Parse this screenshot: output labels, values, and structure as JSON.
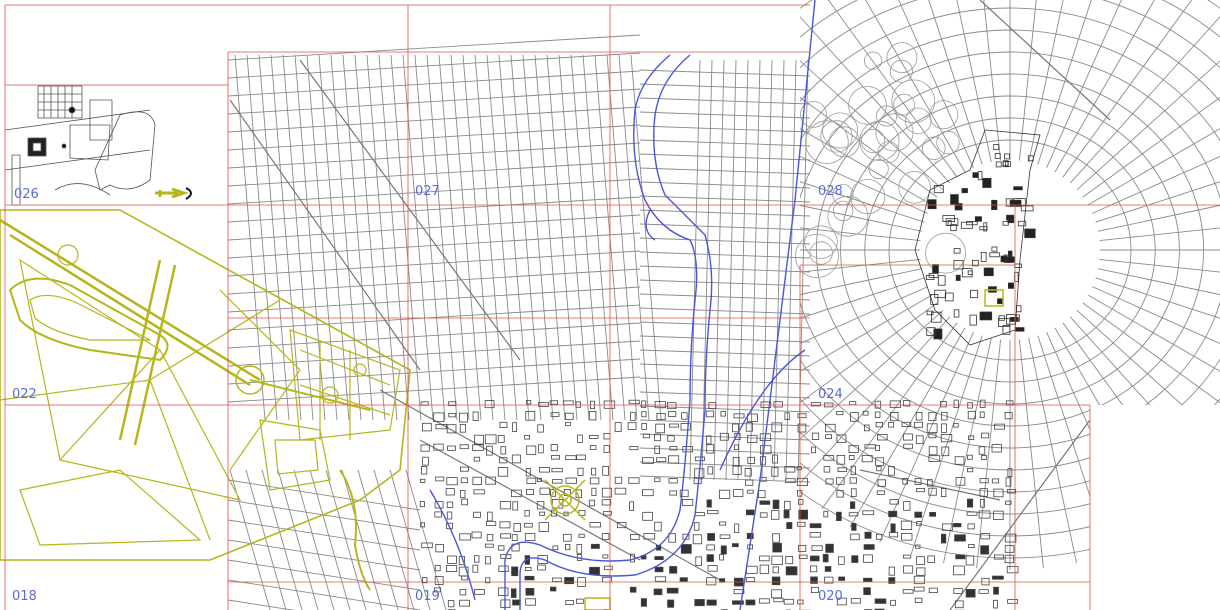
{
  "colors": {
    "background": "#ffffff",
    "street": "#8a8a8a",
    "block": "#555555",
    "grid": "#e0504a",
    "river": "#4a55d8",
    "park": "#b7b51c",
    "label": "#5b6bd6"
  },
  "sheets": [
    {
      "id": "sheet-026",
      "label": "026"
    },
    {
      "id": "sheet-027",
      "label": "027"
    },
    {
      "id": "sheet-028",
      "label": "028"
    },
    {
      "id": "sheet-022",
      "label": "022"
    },
    {
      "id": "sheet-024",
      "label": "024"
    },
    {
      "id": "sheet-018",
      "label": "018"
    },
    {
      "id": "sheet-019",
      "label": "019"
    },
    {
      "id": "sheet-020",
      "label": "020"
    }
  ]
}
